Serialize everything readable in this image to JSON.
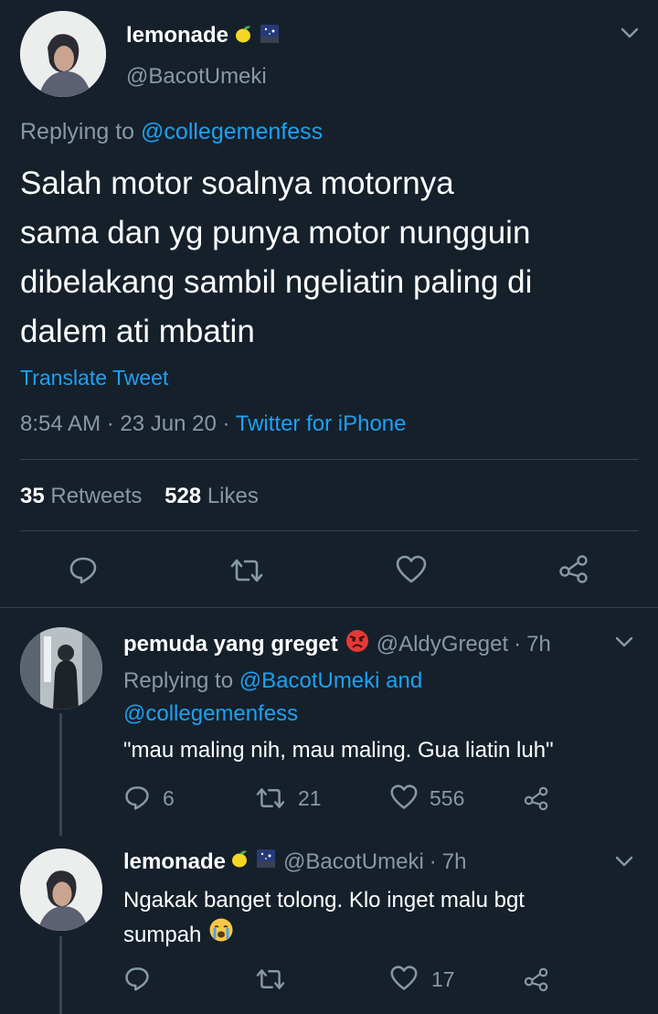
{
  "main_tweet": {
    "display_name": "lemonade",
    "handle": "@BacotUmeki",
    "replying_prefix": "Replying to",
    "replying_to": "@collegemenfess",
    "text_lines": [
      "Salah motor soalnya motornya",
      "sama dan yg punya motor nungguin",
      "dibelakang sambil ngeliatin paling di",
      "dalem ati mbatin"
    ],
    "translate": "Translate Tweet",
    "time": "8:54 AM",
    "date": "23 Jun 20",
    "source": "Twitter for iPhone",
    "retweets_count": "35",
    "retweets_label": "Retweets",
    "likes_count": "528",
    "likes_label": "Likes"
  },
  "replies": [
    {
      "display_name": "pemuda yang greget",
      "handle": "@AldyGreget",
      "time": "7h",
      "replying_prefix": "Replying to",
      "replying_to_1": "@BacotUmeki",
      "replying_and": "and",
      "replying_to_2": "@collegemenfess",
      "text": "\"mau maling nih, mau maling. Gua liatin luh\"",
      "replies": "6",
      "retweets": "21",
      "likes": "556"
    },
    {
      "display_name": "lemonade",
      "handle": "@BacotUmeki",
      "time": "7h",
      "text_line1": "Ngakak banget tolong. Klo inget malu bgt",
      "text_line2": "sumpah",
      "likes": "17"
    }
  ],
  "separator": "·",
  "colors": {
    "background": "#15202b",
    "accent": "#1da1f2",
    "muted": "#8899a6",
    "divider": "#38444d"
  }
}
